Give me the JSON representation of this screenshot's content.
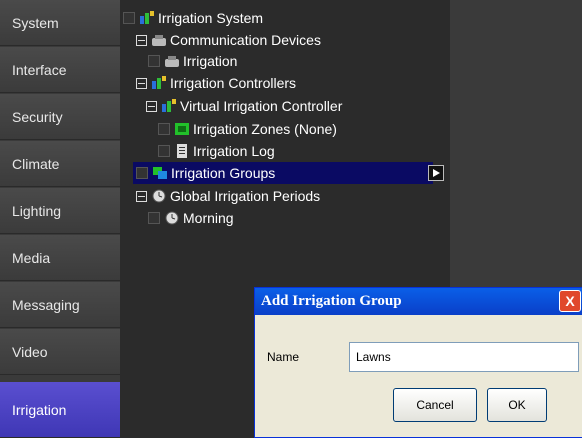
{
  "sidebar": {
    "items": [
      {
        "label": "System"
      },
      {
        "label": "Interface"
      },
      {
        "label": "Security"
      },
      {
        "label": "Climate"
      },
      {
        "label": "Lighting"
      },
      {
        "label": "Media"
      },
      {
        "label": "Messaging"
      },
      {
        "label": "Video"
      },
      {
        "label": "Irrigation"
      }
    ],
    "active": "Irrigation",
    "accent_color": "#4b43c6"
  },
  "tree": {
    "nodes": [
      {
        "label": "Irrigation System",
        "icon": "irrigation-system-icon"
      },
      {
        "label": "Communication Devices",
        "icon": "communication-device-icon"
      },
      {
        "label": "Irrigation",
        "icon": "communication-device-icon"
      },
      {
        "label": "Irrigation Controllers",
        "icon": "irrigation-system-icon"
      },
      {
        "label": "Virtual Irrigation Controller",
        "icon": "irrigation-system-icon"
      },
      {
        "label": "Irrigation Zones (None)",
        "icon": "irrigation-zone-icon"
      },
      {
        "label": "Irrigation Log",
        "icon": "log-icon"
      },
      {
        "label": "Irrigation Groups",
        "icon": "irrigation-group-icon"
      },
      {
        "label": "Global Irrigation Periods",
        "icon": "clock-icon"
      },
      {
        "label": "Morning",
        "icon": "clock-icon"
      }
    ],
    "selected": "Irrigation Groups",
    "selected_color": "#0a0a63"
  },
  "dialog": {
    "title": "Add Irrigation Group",
    "close_label": "X",
    "name_label": "Name",
    "name_value": "Lawns",
    "cancel_label": "Cancel",
    "ok_label": "OK"
  }
}
